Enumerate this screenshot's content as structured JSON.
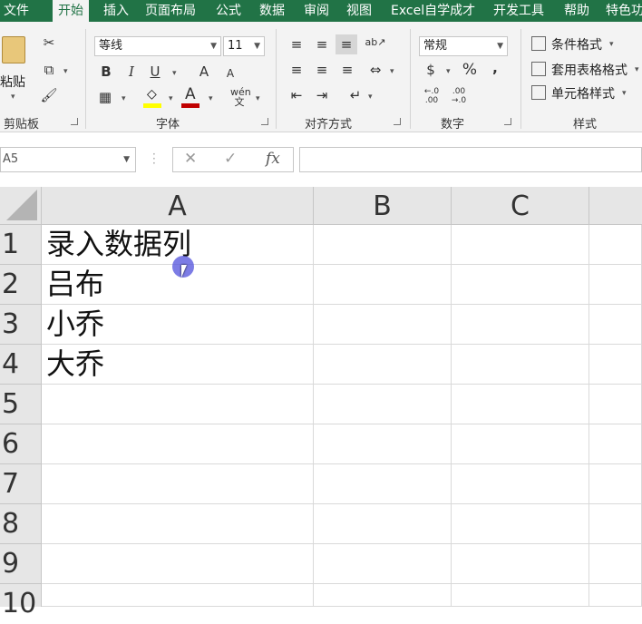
{
  "tabs": [
    "文件",
    "开始",
    "插入",
    "页面布局",
    "公式",
    "数据",
    "审阅",
    "视图",
    "Excel自学成才",
    "开发工具",
    "帮助",
    "特色功"
  ],
  "ribbon": {
    "clipboard": {
      "paste_label": "粘贴",
      "group_label": "剪贴板"
    },
    "font": {
      "font_name": "等线",
      "font_size": "11",
      "bold": "B",
      "italic": "I",
      "underline": "U",
      "grow": "A",
      "shrink": "A",
      "font_color": "A",
      "phonetic": "wén\n文",
      "group_label": "字体"
    },
    "alignment": {
      "group_label": "对齐方式"
    },
    "number": {
      "format": "常规",
      "percent": "%",
      "comma": ",",
      "group_label": "数字"
    },
    "styles": {
      "conditional": "条件格式",
      "table": "套用表格格式",
      "cell": "单元格样式",
      "group_label": "样式"
    }
  },
  "formula_bar": {
    "name_box": "A5",
    "cancel": "✕",
    "enter": "✓",
    "fx": "fx",
    "content": ""
  },
  "grid": {
    "columns": [
      "A",
      "B",
      "C"
    ],
    "rows": [
      "1",
      "2",
      "3",
      "4",
      "5",
      "6",
      "7",
      "8",
      "9",
      "10"
    ],
    "cells": {
      "A1": "录入数据列",
      "A2": "吕布",
      "A3": "小乔",
      "A4": "大乔"
    }
  },
  "colors": {
    "accent": "#217346",
    "font_color_bar": "#c00000",
    "highlight": "#ffff00"
  }
}
